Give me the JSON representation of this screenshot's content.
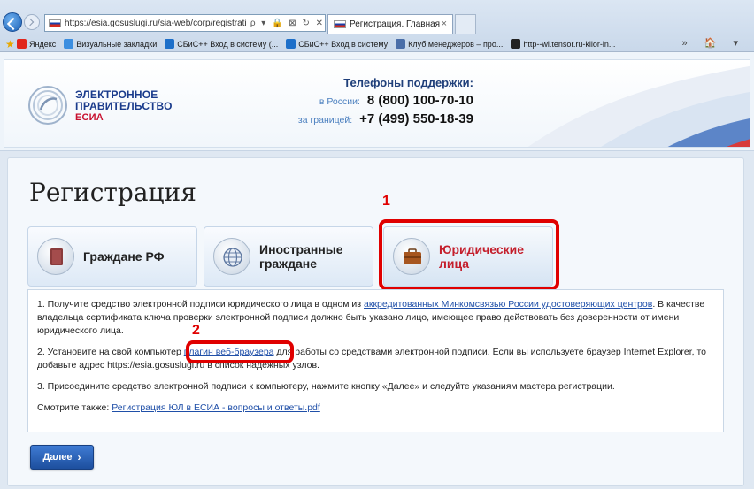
{
  "browser": {
    "url": "https://esia.gosuslugi.ru/sia-web/corp/registration/eds/Ind",
    "address_icons": "ρ ▾ 🔒 ⊠ ↻ ✕",
    "tab_title": "Регистрация. Главная",
    "tab_close": "×",
    "favorites": [
      {
        "label": "Яндекс",
        "icon": "yandex-icon",
        "color": "#e1261c"
      },
      {
        "label": "Визуальные закладки",
        "icon": "bookmarks-icon",
        "color": "#3b8ee0"
      },
      {
        "label": "СБиС++ Вход в систему (...",
        "icon": "sbis-icon",
        "color": "#1d6fc9"
      },
      {
        "label": "СБиС++ Вход в систему",
        "icon": "sbis-icon",
        "color": "#1d6fc9"
      },
      {
        "label": "Клуб менеджеров – про...",
        "icon": "club-icon",
        "color": "#4a6ea8"
      },
      {
        "label": "http--wi.tensor.ru-kilor-in...",
        "icon": "tensor-icon",
        "color": "#222"
      }
    ],
    "favorites_right": "» 🏠 ▾"
  },
  "header": {
    "logo_line1": "ЭЛЕКТРОННОЕ",
    "logo_line2": "ПРАВИТЕЛЬСТВО",
    "logo_line3": "ЕСИА",
    "phones_title": "Телефоны поддержки:",
    "russia_label": "в России:",
    "russia_phone": "8 (800) 100-70-10",
    "abroad_label": "за границей:",
    "abroad_phone": "+7 (499) 550-18-39"
  },
  "main": {
    "title": "Регистрация",
    "tabs": [
      {
        "line1": "Граждане РФ",
        "line2": ""
      },
      {
        "line1": "Иностранные",
        "line2": "граждане"
      },
      {
        "line1": "Юридические",
        "line2": "лица"
      }
    ],
    "annotations": {
      "one": "1",
      "two": "2"
    },
    "steps": {
      "s1_pre": "1.   Получите средство электронной подписи юридического лица в одном из ",
      "s1_link": "аккредитованных Минкомсвязью России удостоверяющих центров",
      "s1_post": ". В качестве владельца сертификата ключа проверки электронной подписи должно быть указано лицо, имеющее право действовать без доверенности от имени юридического лица.",
      "s2_pre": "2.   Установите на свой компьютер ",
      "s2_link": "плагин веб-браузера",
      "s2_post": " для работы со средствами электронной подписи. Если вы используете браузер Internet Explorer, то добавьте адрес https://esia.gosuslugi.ru в список надёжных узлов.",
      "s3": "3.   Присоедините средство электронной подписи к компьютеру, нажмите кнопку «Далее» и следуйте указаниям мастера регистрации.",
      "see_also_pre": "Смотрите также: ",
      "see_also_link": "Регистрация ЮЛ в ЕСИА - вопросы и ответы.pdf"
    },
    "next_label": "Далее",
    "next_chevron": "›"
  },
  "colors": {
    "accent": "#1d4f9e",
    "annotation": "#e00000",
    "legal_tab": "#c41e2b"
  }
}
